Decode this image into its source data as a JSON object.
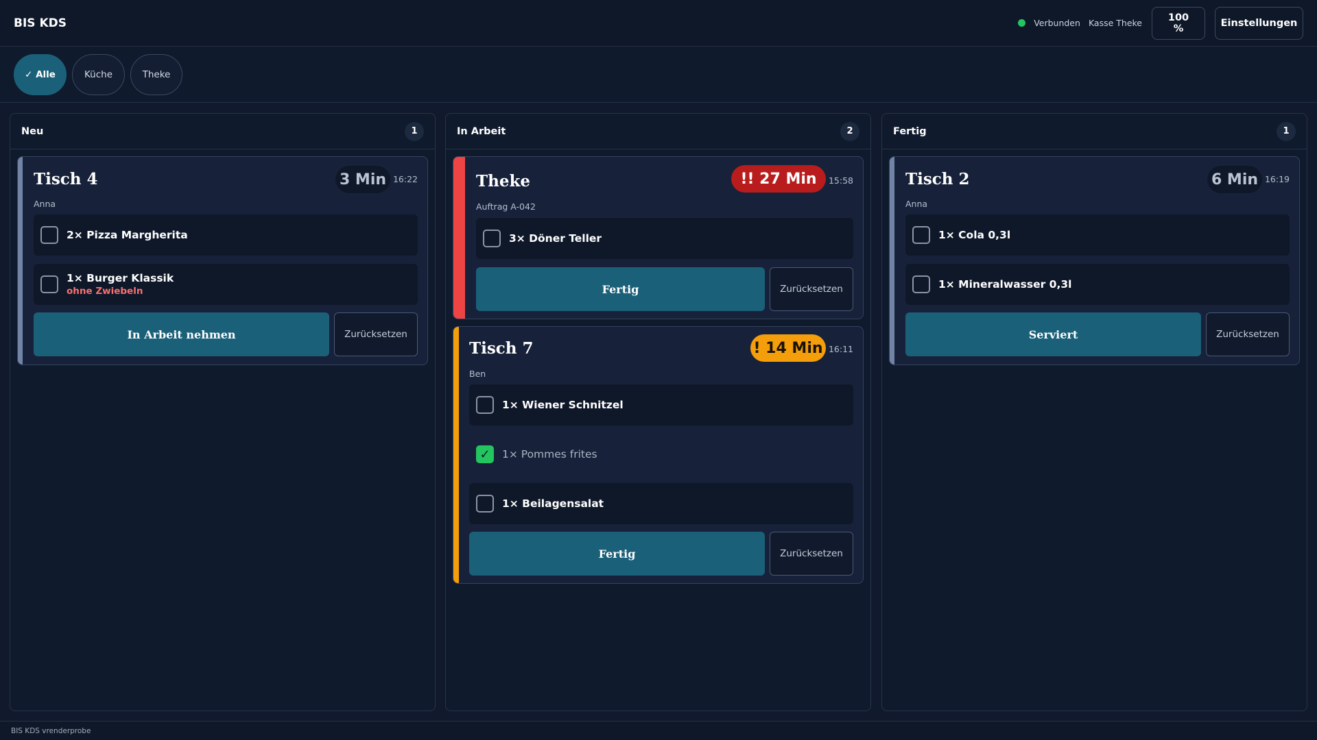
{
  "app": {
    "title": "BIS KDS"
  },
  "topbar": {
    "status_label": "Verbunden",
    "station_label": "Kasse Theke",
    "zoom_label": "100 %",
    "settings_label": "Einstellungen",
    "status_color": "#22c55e"
  },
  "filters": [
    {
      "label": "✓ Alle",
      "active": true
    },
    {
      "label": "Küche",
      "active": false
    },
    {
      "label": "Theke",
      "active": false
    }
  ],
  "columns": {
    "neu": {
      "title": "Neu",
      "count": "1",
      "cards": [
        {
          "title": "Tisch 4",
          "subtitle": "Anna",
          "timer": "3 Min",
          "time": "16:22",
          "items": [
            {
              "label": "2× Pizza Margherita",
              "checked": false
            },
            {
              "label": "1× Burger Klassik",
              "note": "ohne Zwiebeln",
              "checked": false
            }
          ],
          "primary_label": "In Arbeit nehmen",
          "reset_label": "Zurücksetzen"
        }
      ]
    },
    "in_arbeit": {
      "title": "In Arbeit",
      "count": "2",
      "cards": [
        {
          "title": "Theke",
          "subtitle": "Auftrag A-042",
          "timer": "!! 27 Min",
          "time": "15:58",
          "items": [
            {
              "label": "3× Döner Teller",
              "checked": false
            }
          ],
          "primary_label": "Fertig",
          "reset_label": "Zurücksetzen"
        },
        {
          "title": "Tisch 7",
          "subtitle": "Ben",
          "timer": "! 14 Min",
          "time": "16:11",
          "items": [
            {
              "label": "1× Wiener Schnitzel",
              "checked": false
            },
            {
              "label": "1× Pommes frites",
              "checked": true
            },
            {
              "label": "1× Beilagensalat",
              "checked": false
            }
          ],
          "primary_label": "Fertig",
          "reset_label": "Zurücksetzen"
        }
      ]
    },
    "fertig": {
      "title": "Fertig",
      "count": "1",
      "cards": [
        {
          "title": "Tisch 2",
          "subtitle": "Anna",
          "timer": "6 Min",
          "time": "16:19",
          "items": [
            {
              "label": "1× Cola 0,3l",
              "checked": false
            },
            {
              "label": "1× Mineralwasser 0,3l",
              "checked": false
            }
          ],
          "primary_label": "Serviert",
          "reset_label": "Zurücksetzen"
        }
      ]
    }
  },
  "footer": {
    "text": "BIS KDS vrenderprobe"
  },
  "colors": {
    "accent": "#1b6079",
    "urgent": "#b91c1c",
    "warning": "#f59e0b",
    "done": "#22c55e",
    "neutral_stripe": "#7184a6"
  }
}
